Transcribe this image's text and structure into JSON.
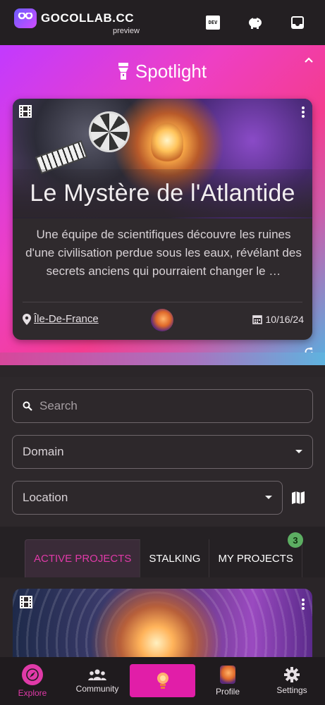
{
  "header": {
    "brand": "GoCollab.cc",
    "brand_display": "GOCOLLAB.CC",
    "sub": "preview",
    "dev_label": "DEV"
  },
  "spotlight": {
    "title": "Spotlight",
    "card": {
      "title": "Le Mystère de l'Atlantide",
      "description": "Une équipe de scientifiques découvre les ruines d'une civilisation perdue sous les eaux, révélant des secrets anciens qui pourraient changer le …",
      "location": "Île-De-France",
      "date": "10/16/24"
    }
  },
  "filters": {
    "search_placeholder": "Search",
    "domain_label": "Domain",
    "location_label": "Location"
  },
  "tabs": {
    "items": [
      {
        "label": "ACTIVE PROJECTS"
      },
      {
        "label": "STALKING"
      },
      {
        "label": "MY PROJECTS"
      }
    ],
    "my_projects_count": "3"
  },
  "bottom_nav": {
    "explore": "Explore",
    "community": "Community",
    "profile": "Profile",
    "settings": "Settings"
  },
  "colors": {
    "accent": "#e03aa8",
    "badge": "#5cae62",
    "background": "#2b2629"
  }
}
